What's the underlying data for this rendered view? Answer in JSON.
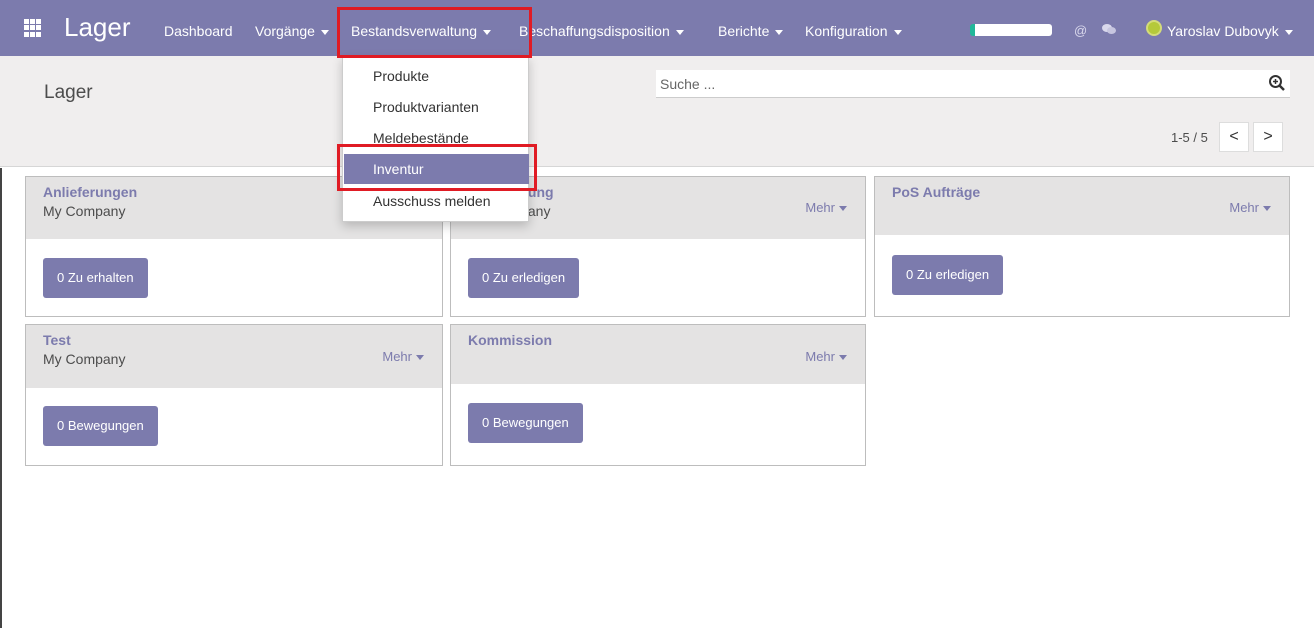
{
  "topbar": {
    "brand": "Lager",
    "nav": [
      {
        "label": "Dashboard"
      },
      {
        "label": "Vorgänge"
      },
      {
        "label": "Bestandsverwaltung"
      },
      {
        "label": "Beschaffungsdisposition"
      },
      {
        "label": "Berichte"
      },
      {
        "label": "Konfiguration"
      }
    ],
    "at_symbol": "@",
    "user_name": "Yaroslav Dubovyk"
  },
  "control_panel": {
    "title": "Lager",
    "search_placeholder": "Suche ...",
    "pager_value": "1-5 / 5",
    "pager_prev": "<",
    "pager_next": ">"
  },
  "dropdown": {
    "items": [
      {
        "label": "Produkte"
      },
      {
        "label": "Produktvarianten"
      },
      {
        "label": "Meldebestände"
      },
      {
        "label": "Inventur"
      },
      {
        "label": "Ausschuss melden"
      }
    ]
  },
  "cards": [
    {
      "title": "Anlieferungen",
      "subtitle": "My Company",
      "mehr": "Mehr",
      "button": "0 Zu erhalten"
    },
    {
      "title": "Auslieferung",
      "subtitle": "My Company",
      "mehr": "Mehr",
      "button": "0 Zu erledigen"
    },
    {
      "title": "PoS Aufträge",
      "subtitle": "",
      "mehr": "Mehr",
      "button": "0 Zu erledigen"
    },
    {
      "title": "Test",
      "subtitle": "My Company",
      "mehr": "Mehr",
      "button": "0 Bewegungen"
    },
    {
      "title": "Kommission",
      "subtitle": "",
      "mehr": "Mehr",
      "button": "0 Bewegungen"
    }
  ],
  "colors": {
    "accent": "#7c7bad",
    "highlight": "#e01b24"
  }
}
